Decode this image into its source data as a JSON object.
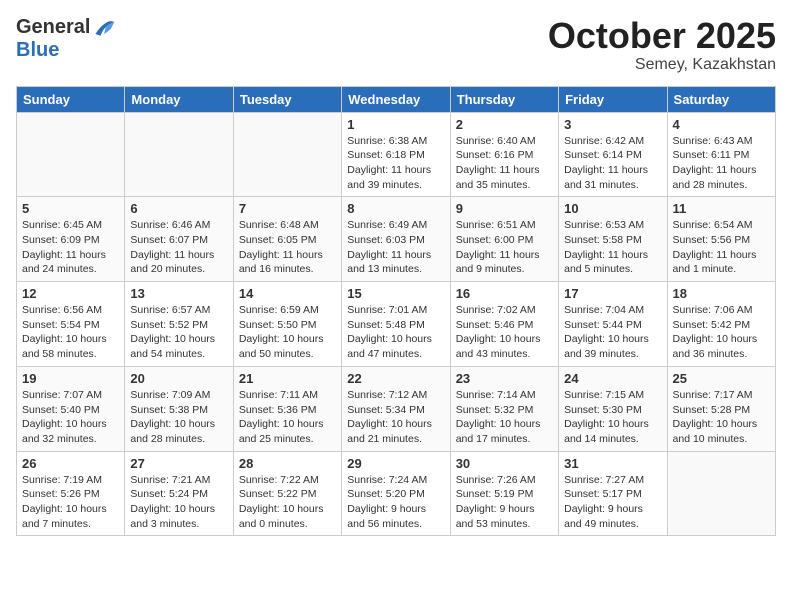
{
  "header": {
    "logo_general": "General",
    "logo_blue": "Blue",
    "month": "October 2025",
    "location": "Semey, Kazakhstan"
  },
  "weekdays": [
    "Sunday",
    "Monday",
    "Tuesday",
    "Wednesday",
    "Thursday",
    "Friday",
    "Saturday"
  ],
  "weeks": [
    [
      {
        "day": "",
        "info": ""
      },
      {
        "day": "",
        "info": ""
      },
      {
        "day": "",
        "info": ""
      },
      {
        "day": "1",
        "info": "Sunrise: 6:38 AM\nSunset: 6:18 PM\nDaylight: 11 hours\nand 39 minutes."
      },
      {
        "day": "2",
        "info": "Sunrise: 6:40 AM\nSunset: 6:16 PM\nDaylight: 11 hours\nand 35 minutes."
      },
      {
        "day": "3",
        "info": "Sunrise: 6:42 AM\nSunset: 6:14 PM\nDaylight: 11 hours\nand 31 minutes."
      },
      {
        "day": "4",
        "info": "Sunrise: 6:43 AM\nSunset: 6:11 PM\nDaylight: 11 hours\nand 28 minutes."
      }
    ],
    [
      {
        "day": "5",
        "info": "Sunrise: 6:45 AM\nSunset: 6:09 PM\nDaylight: 11 hours\nand 24 minutes."
      },
      {
        "day": "6",
        "info": "Sunrise: 6:46 AM\nSunset: 6:07 PM\nDaylight: 11 hours\nand 20 minutes."
      },
      {
        "day": "7",
        "info": "Sunrise: 6:48 AM\nSunset: 6:05 PM\nDaylight: 11 hours\nand 16 minutes."
      },
      {
        "day": "8",
        "info": "Sunrise: 6:49 AM\nSunset: 6:03 PM\nDaylight: 11 hours\nand 13 minutes."
      },
      {
        "day": "9",
        "info": "Sunrise: 6:51 AM\nSunset: 6:00 PM\nDaylight: 11 hours\nand 9 minutes."
      },
      {
        "day": "10",
        "info": "Sunrise: 6:53 AM\nSunset: 5:58 PM\nDaylight: 11 hours\nand 5 minutes."
      },
      {
        "day": "11",
        "info": "Sunrise: 6:54 AM\nSunset: 5:56 PM\nDaylight: 11 hours\nand 1 minute."
      }
    ],
    [
      {
        "day": "12",
        "info": "Sunrise: 6:56 AM\nSunset: 5:54 PM\nDaylight: 10 hours\nand 58 minutes."
      },
      {
        "day": "13",
        "info": "Sunrise: 6:57 AM\nSunset: 5:52 PM\nDaylight: 10 hours\nand 54 minutes."
      },
      {
        "day": "14",
        "info": "Sunrise: 6:59 AM\nSunset: 5:50 PM\nDaylight: 10 hours\nand 50 minutes."
      },
      {
        "day": "15",
        "info": "Sunrise: 7:01 AM\nSunset: 5:48 PM\nDaylight: 10 hours\nand 47 minutes."
      },
      {
        "day": "16",
        "info": "Sunrise: 7:02 AM\nSunset: 5:46 PM\nDaylight: 10 hours\nand 43 minutes."
      },
      {
        "day": "17",
        "info": "Sunrise: 7:04 AM\nSunset: 5:44 PM\nDaylight: 10 hours\nand 39 minutes."
      },
      {
        "day": "18",
        "info": "Sunrise: 7:06 AM\nSunset: 5:42 PM\nDaylight: 10 hours\nand 36 minutes."
      }
    ],
    [
      {
        "day": "19",
        "info": "Sunrise: 7:07 AM\nSunset: 5:40 PM\nDaylight: 10 hours\nand 32 minutes."
      },
      {
        "day": "20",
        "info": "Sunrise: 7:09 AM\nSunset: 5:38 PM\nDaylight: 10 hours\nand 28 minutes."
      },
      {
        "day": "21",
        "info": "Sunrise: 7:11 AM\nSunset: 5:36 PM\nDaylight: 10 hours\nand 25 minutes."
      },
      {
        "day": "22",
        "info": "Sunrise: 7:12 AM\nSunset: 5:34 PM\nDaylight: 10 hours\nand 21 minutes."
      },
      {
        "day": "23",
        "info": "Sunrise: 7:14 AM\nSunset: 5:32 PM\nDaylight: 10 hours\nand 17 minutes."
      },
      {
        "day": "24",
        "info": "Sunrise: 7:15 AM\nSunset: 5:30 PM\nDaylight: 10 hours\nand 14 minutes."
      },
      {
        "day": "25",
        "info": "Sunrise: 7:17 AM\nSunset: 5:28 PM\nDaylight: 10 hours\nand 10 minutes."
      }
    ],
    [
      {
        "day": "26",
        "info": "Sunrise: 7:19 AM\nSunset: 5:26 PM\nDaylight: 10 hours\nand 7 minutes."
      },
      {
        "day": "27",
        "info": "Sunrise: 7:21 AM\nSunset: 5:24 PM\nDaylight: 10 hours\nand 3 minutes."
      },
      {
        "day": "28",
        "info": "Sunrise: 7:22 AM\nSunset: 5:22 PM\nDaylight: 10 hours\nand 0 minutes."
      },
      {
        "day": "29",
        "info": "Sunrise: 7:24 AM\nSunset: 5:20 PM\nDaylight: 9 hours\nand 56 minutes."
      },
      {
        "day": "30",
        "info": "Sunrise: 7:26 AM\nSunset: 5:19 PM\nDaylight: 9 hours\nand 53 minutes."
      },
      {
        "day": "31",
        "info": "Sunrise: 7:27 AM\nSunset: 5:17 PM\nDaylight: 9 hours\nand 49 minutes."
      },
      {
        "day": "",
        "info": ""
      }
    ]
  ]
}
